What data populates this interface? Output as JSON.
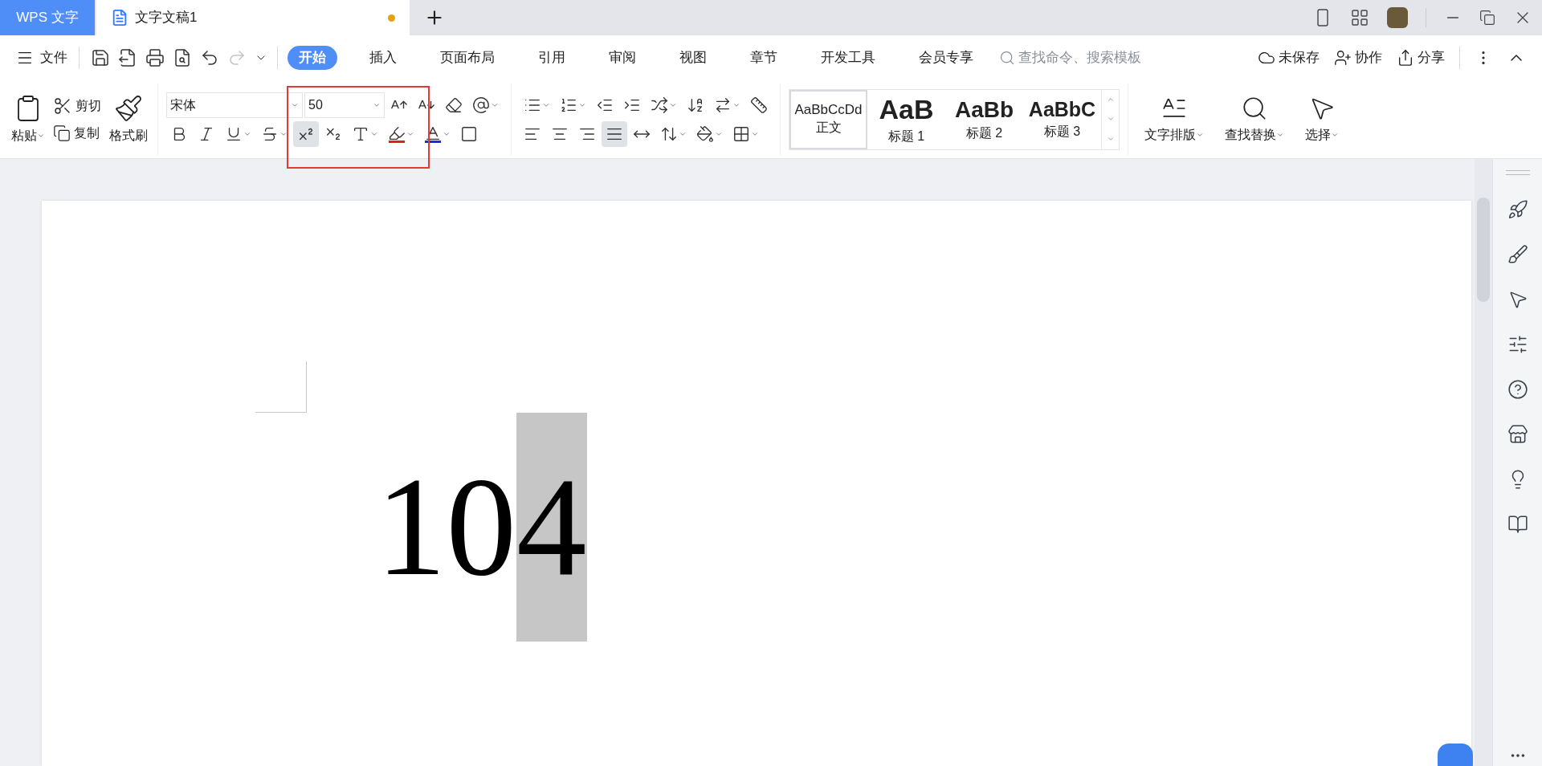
{
  "app_tab": {
    "label": "WPS 文字"
  },
  "doc_tab": {
    "title": "文字文稿1",
    "unsaved": true
  },
  "menu": {
    "file": "文件",
    "quick_tools": [
      {
        "kind": "save",
        "disabled": false
      },
      {
        "kind": "export",
        "disabled": false
      },
      {
        "kind": "print",
        "disabled": false
      },
      {
        "kind": "preview",
        "disabled": false
      },
      {
        "kind": "undo",
        "disabled": false
      },
      {
        "kind": "redo",
        "disabled": true
      },
      {
        "kind": "more",
        "disabled": false
      }
    ],
    "tabs": [
      {
        "label": "开始",
        "selected": true
      },
      {
        "label": "插入",
        "selected": false
      },
      {
        "label": "页面布局",
        "selected": false
      },
      {
        "label": "引用",
        "selected": false
      },
      {
        "label": "审阅",
        "selected": false
      },
      {
        "label": "视图",
        "selected": false
      },
      {
        "label": "章节",
        "selected": false
      },
      {
        "label": "开发工具",
        "selected": false
      },
      {
        "label": "会员专享",
        "selected": false
      }
    ],
    "search": {
      "placeholder": "查找命令、搜索模板"
    },
    "actions": [
      {
        "kind": "cloud",
        "label": "未保存"
      },
      {
        "kind": "collab",
        "label": "协作"
      },
      {
        "kind": "share",
        "label": "分享"
      }
    ]
  },
  "ribbon": {
    "clipboard": {
      "paste": "粘贴",
      "cut": "剪切",
      "copy": "复制",
      "painter": "格式刷"
    },
    "font": {
      "name": "宋体",
      "size": "50"
    },
    "font_tools_top": [
      {
        "kind": "grow",
        "has_menu": false
      },
      {
        "kind": "shrink",
        "has_menu": false
      },
      {
        "kind": "clear",
        "has_menu": false
      },
      {
        "kind": "phonetic",
        "has_menu": true
      }
    ],
    "font_tools_bottom": [
      {
        "kind": "bold",
        "selected": false,
        "has_menu": false
      },
      {
        "kind": "italic",
        "selected": false,
        "has_menu": false
      },
      {
        "kind": "underline",
        "selected": false,
        "has_menu": true
      },
      {
        "kind": "strike",
        "selected": false,
        "has_menu": true
      },
      {
        "kind": "superscript",
        "selected": true,
        "has_menu": false
      },
      {
        "kind": "subscript",
        "selected": false,
        "has_menu": false
      },
      {
        "kind": "effect",
        "selected": false,
        "has_menu": true
      },
      {
        "kind": "highlight",
        "selected": false,
        "has_menu": true
      },
      {
        "kind": "color",
        "selected": false,
        "has_menu": true
      },
      {
        "kind": "border",
        "selected": false,
        "has_menu": false
      }
    ],
    "para_top": [
      {
        "kind": "bullets",
        "has_menu": true
      },
      {
        "kind": "numbering",
        "has_menu": true
      },
      {
        "kind": "outdent",
        "has_menu": false
      },
      {
        "kind": "indent",
        "has_menu": false
      },
      {
        "kind": "asian",
        "has_menu": true
      },
      {
        "kind": "sort",
        "has_menu": false
      },
      {
        "kind": "marks",
        "has_menu": true
      },
      {
        "kind": "ruler",
        "has_menu": false
      }
    ],
    "para_bottom": [
      {
        "kind": "left",
        "selected": false,
        "has_menu": false
      },
      {
        "kind": "center",
        "selected": false,
        "has_menu": false
      },
      {
        "kind": "right",
        "selected": false,
        "has_menu": false
      },
      {
        "kind": "justify",
        "selected": true,
        "has_menu": false
      },
      {
        "kind": "distribute",
        "selected": false,
        "has_menu": false
      },
      {
        "kind": "spacing",
        "selected": false,
        "has_menu": true
      },
      {
        "kind": "shading",
        "selected": false,
        "has_menu": true
      },
      {
        "kind": "borders",
        "selected": false,
        "has_menu": true
      }
    ],
    "styles": [
      {
        "kind": "body",
        "preview": "AaBbCcDd",
        "label": "正文",
        "selected": true
      },
      {
        "kind": "heading1",
        "preview": "AaB",
        "label": "标题 1",
        "selected": false
      },
      {
        "kind": "heading2",
        "preview": "AaBb",
        "label": "标题 2",
        "selected": false
      },
      {
        "kind": "heading3",
        "preview": "AaBbC",
        "label": "标题 3",
        "selected": false
      }
    ],
    "big_buttons": [
      {
        "kind": "layout",
        "label": "文字排版"
      },
      {
        "kind": "find",
        "label": "查找替换"
      },
      {
        "kind": "select",
        "label": "选择"
      }
    ]
  },
  "document": {
    "runs": [
      {
        "text": "10",
        "selected": false
      },
      {
        "text": "4",
        "selected": true
      }
    ]
  },
  "sidebar": {
    "tools": [
      {
        "kind": "rocket"
      },
      {
        "kind": "brush"
      },
      {
        "kind": "pointer"
      },
      {
        "kind": "sliders"
      },
      {
        "kind": "help"
      },
      {
        "kind": "store"
      },
      {
        "kind": "bulb"
      },
      {
        "kind": "book"
      }
    ]
  }
}
